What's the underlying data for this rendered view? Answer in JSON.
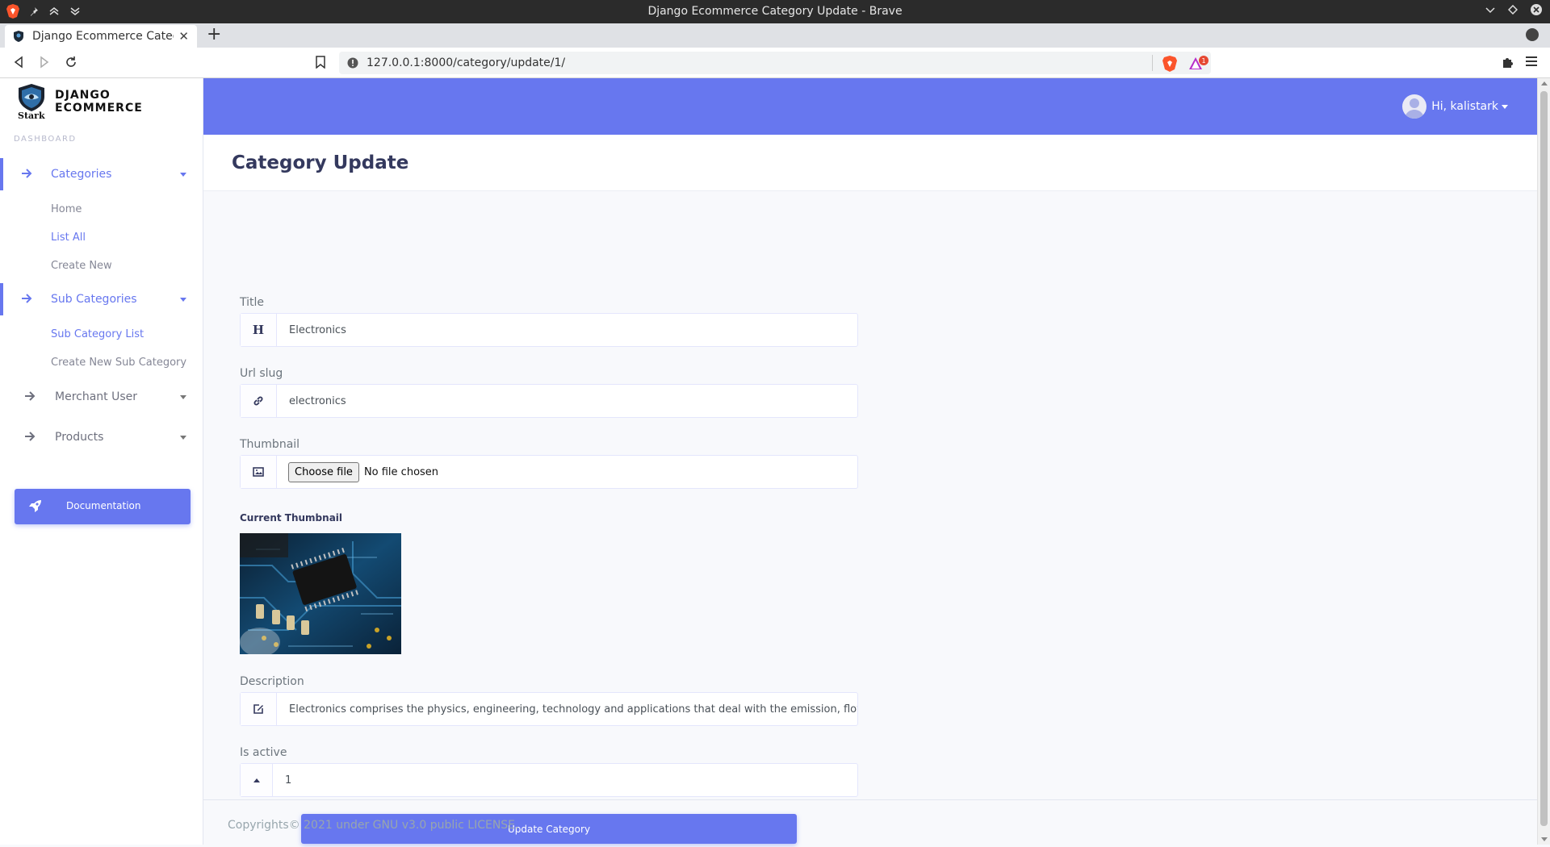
{
  "window": {
    "title": "Django Ecommerce Category Update - Brave"
  },
  "browser": {
    "tab_title": "Django Ecommerce Categor",
    "url": "127.0.0.1:8000/category/update/1/",
    "rewards_badge": "1"
  },
  "sidebar": {
    "brand": "DJANGO ECOMMERCE",
    "brand_sub": "Stark",
    "section": "DASHBOARD",
    "groups": [
      {
        "label": "Categories",
        "items": [
          "Home",
          "List All",
          "Create New"
        ]
      },
      {
        "label": "Sub Categories",
        "items": [
          "Sub Category List",
          "Create New Sub Category"
        ]
      },
      {
        "label": "Merchant User",
        "items": []
      },
      {
        "label": "Products",
        "items": []
      }
    ],
    "documentation": "Documentation"
  },
  "topbar": {
    "greeting": "Hi, kalistark"
  },
  "page": {
    "title": "Category Update"
  },
  "form": {
    "title_label": "Title",
    "title_value": "Electronics",
    "slug_label": "Url slug",
    "slug_value": "electronics",
    "thumbnail_label": "Thumbnail",
    "choose_file": "Choose file",
    "no_file": "No file chosen",
    "current_thumbnail": "Current Thumbnail",
    "description_label": "Description",
    "description_value": "Electronics comprises the physics, engineering, technology and applications that deal with the emission, flow a",
    "active_label": "Is active",
    "active_value": "1",
    "submit": "Update Category"
  },
  "footer": {
    "text": "Copyrights© 2021 under GNU v3.0 public LICENSE."
  },
  "colors": {
    "accent": "#6777ef",
    "sidebar_bg": "#ffffff",
    "page_bg": "#f8f9fc"
  }
}
